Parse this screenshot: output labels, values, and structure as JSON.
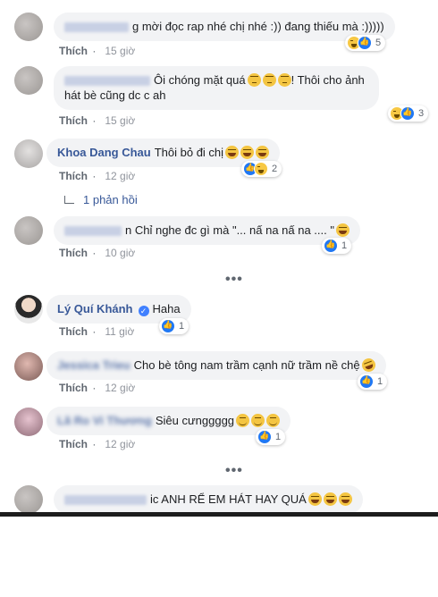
{
  "comments": [
    {
      "author": "",
      "text": "g mời đọc rap nhé chị nhé :)) đang thiếu mà :)))))",
      "like": "Thích",
      "time": "15 giờ",
      "reactions": "5"
    },
    {
      "author": "",
      "text": "Ôi chóng mặt quá",
      "text2": "! Thôi cho ảnh hát bè cũng dc c ah",
      "like": "Thích",
      "time": "15 giờ",
      "reactions": "3"
    },
    {
      "author": "Khoa Dang Chau",
      "text": "Thôi bỏ đi chị",
      "like": "Thích",
      "time": "12 giờ",
      "reactions": "2",
      "reply_count": "1 phản hồi"
    },
    {
      "author": "",
      "text": "n Chỉ nghe đc gì mà \"... nấ na nấ na .... \"",
      "like": "Thích",
      "time": "10 giờ",
      "reactions": "1"
    },
    {
      "author": "Lý Quí Khánh",
      "text": "Haha",
      "like": "Thích",
      "time": "11 giờ",
      "reactions": "1"
    },
    {
      "author": "Jessica Trieu",
      "text": "Cho bè tông nam trầm cạnh nữ trầm nề chệ",
      "like": "Thích",
      "time": "12 giờ",
      "reactions": "1"
    },
    {
      "author": "Lã Ro Vi Thương",
      "text": "Siêu cưnggggg",
      "like": "Thích",
      "time": "12 giờ",
      "reactions": "1"
    },
    {
      "author": "",
      "text": "ic ANH RỂ EM HÁT HAY QUÁ",
      "like": "",
      "time": "",
      "reactions": ""
    }
  ],
  "more_indicator": "•••",
  "colors": {
    "author": "#385898",
    "bubble": "#f2f3f5",
    "meta": "#606770",
    "like": "#2078f4"
  }
}
